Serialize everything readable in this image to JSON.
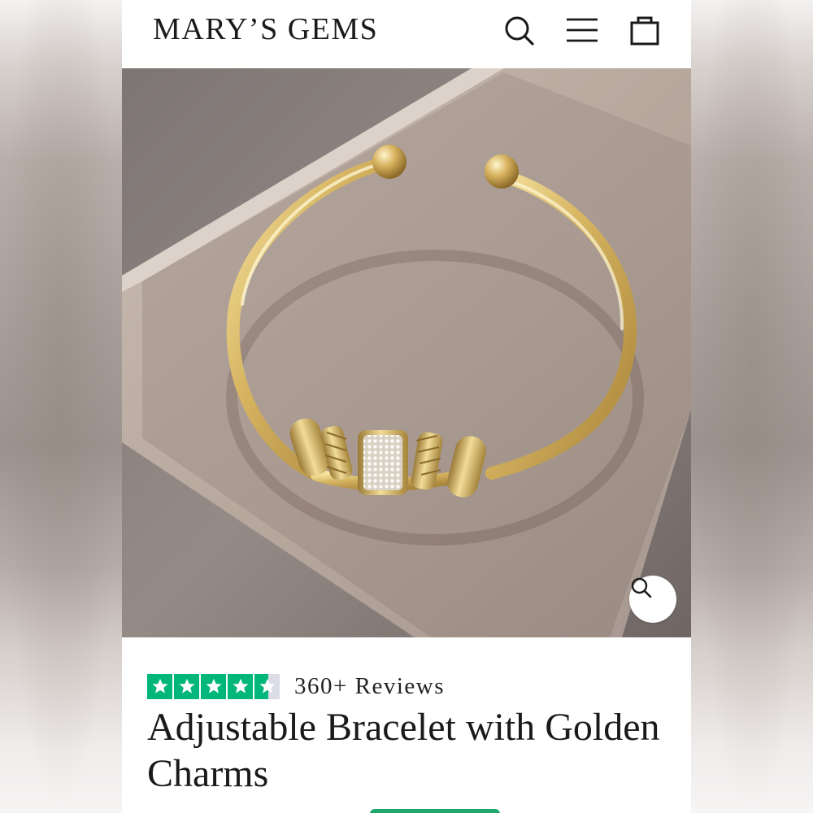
{
  "header": {
    "logo_text": "MARY’S GEMS",
    "icons": [
      "search-icon",
      "menu-icon",
      "cart-icon"
    ]
  },
  "product": {
    "image_alt": "Gold cuff bracelet with charms on a display box",
    "zoom_icon": "zoom-icon",
    "rating": {
      "stars": 4.5,
      "max_stars": 5,
      "star_color": "#00b67a",
      "review_count": "360+ Reviews"
    },
    "title": "Adjustable Bracelet with Golden Charms"
  },
  "colors": {
    "accent_green": "#00b67a",
    "text": "#1a1a1a",
    "background": "#ffffff"
  }
}
